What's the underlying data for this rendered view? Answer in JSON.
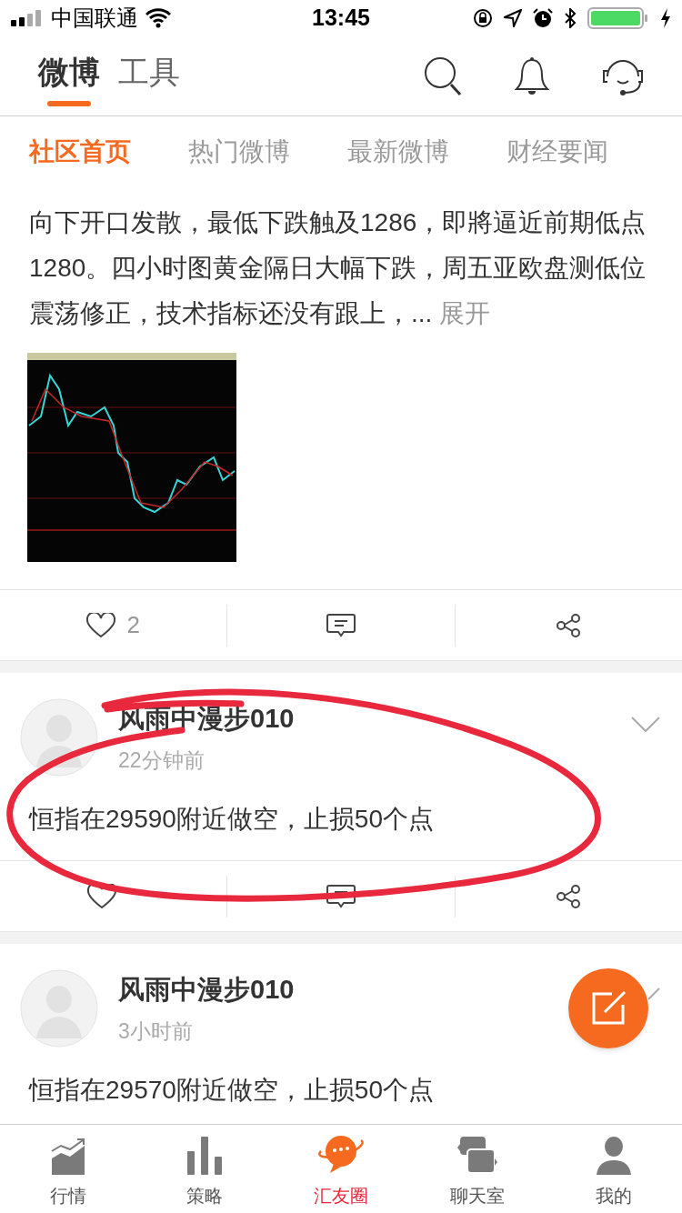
{
  "status_bar": {
    "carrier": "中国联通",
    "time": "13:45"
  },
  "header_tabs": [
    {
      "label": "微博",
      "selected": true
    },
    {
      "label": "工具",
      "selected": false
    }
  ],
  "category_tabs": [
    {
      "label": "社区首页",
      "selected": true
    },
    {
      "label": "热门微博",
      "selected": false
    },
    {
      "label": "最新微博",
      "selected": false
    },
    {
      "label": "财经要闻",
      "selected": false
    }
  ],
  "posts": [
    {
      "text": "向下开口发散，最低下跌触及1286，即將逼近前期低点1280。四小时图黄金隔日大幅下跌，周五亚欧盘测低位震荡修正，技术指标还没有跟上，...",
      "expand_link": "展开",
      "likes": "2"
    },
    {
      "author": "风雨中漫步010",
      "time": "22分钟前",
      "text": "恒指在29590附近做空，止损50个点",
      "menu_covered": false,
      "actions": true
    },
    {
      "author": "风雨中漫步010",
      "time": "3小时前",
      "text": "恒指在29570附近做空，止损50个点",
      "menu_covered": true
    }
  ],
  "annotation": {
    "kind": "ellipse"
  },
  "bottom_nav": [
    {
      "label": "行情",
      "selected": false
    },
    {
      "label": "策略",
      "selected": false
    },
    {
      "label": "汇友圈",
      "selected": true
    },
    {
      "label": "聊天室",
      "selected": false
    },
    {
      "label": "我的",
      "selected": false
    }
  ]
}
